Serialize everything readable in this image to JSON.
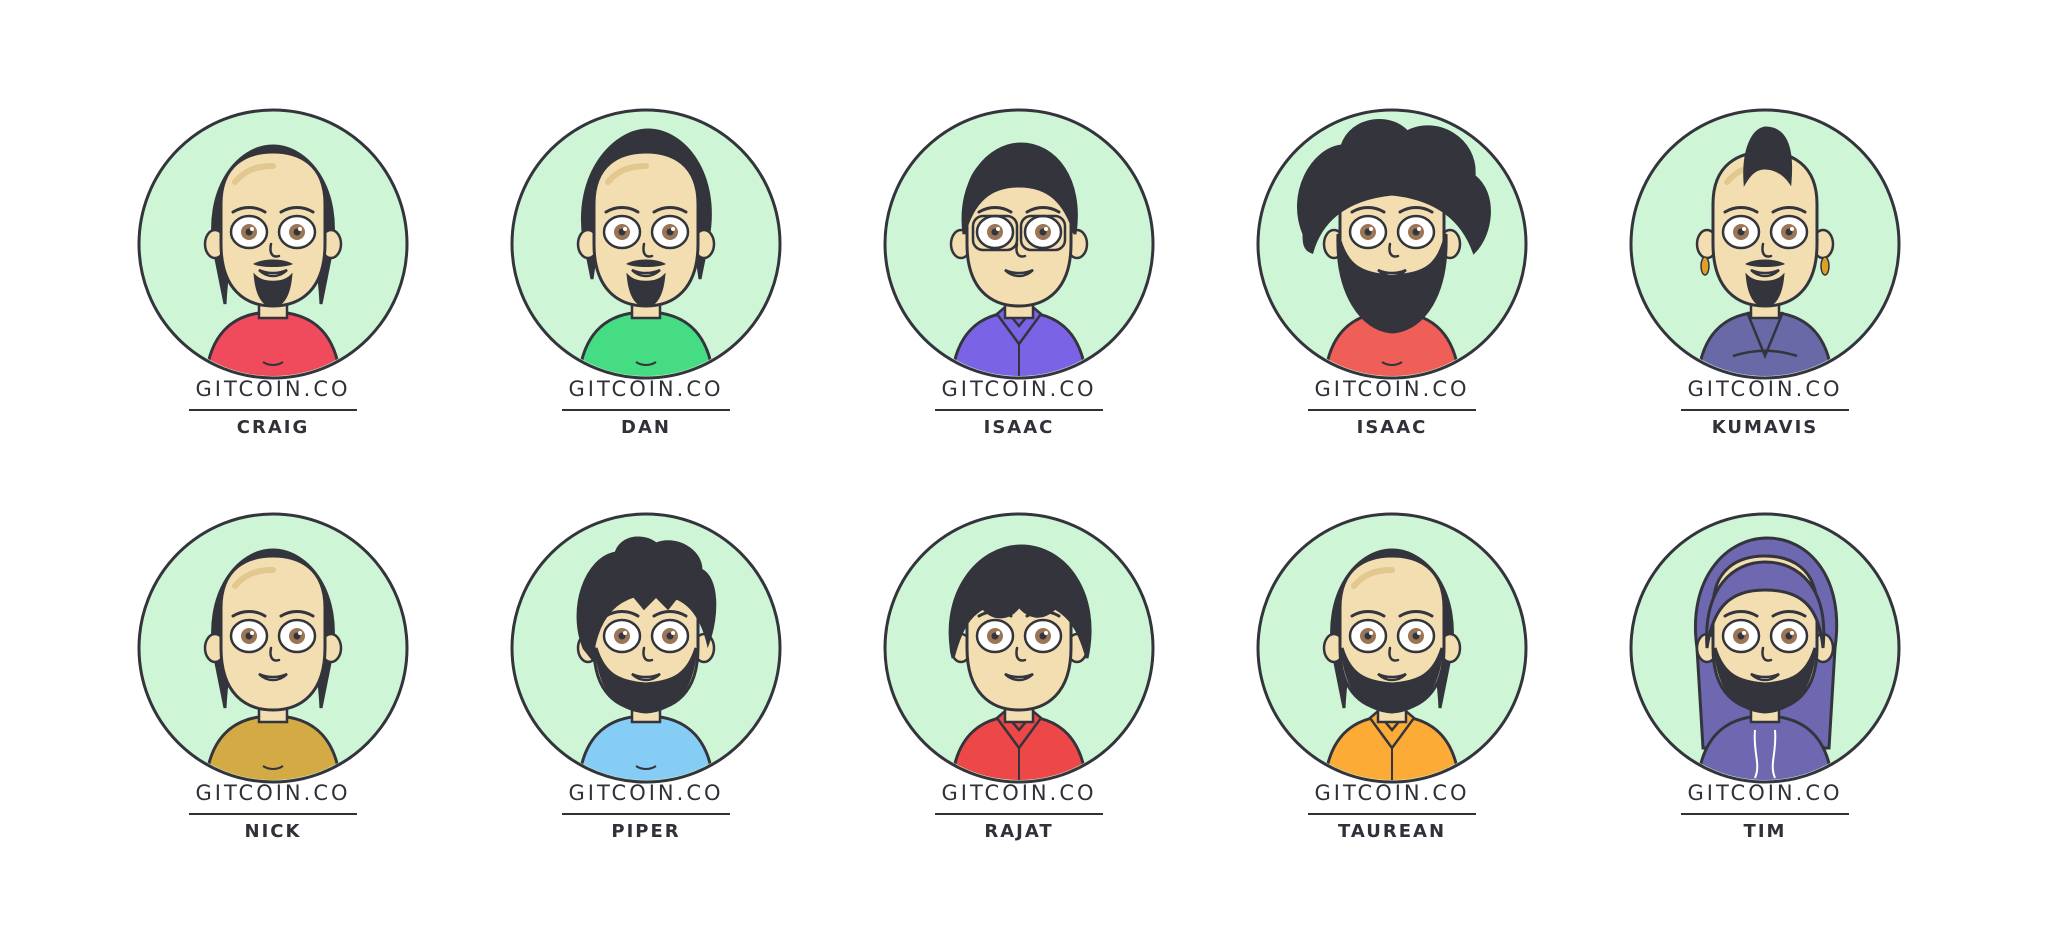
{
  "site_label": "GITCOIN.CO",
  "palette": {
    "circle_fill": "#cdf5d6",
    "outline": "#33343c",
    "skin": "#f2deb0",
    "skin_shadow": "#e2c78e",
    "hair": "#33343c",
    "eye_iris": "#9a7556"
  },
  "avatars": [
    {
      "name": "CRAIG",
      "hair": "long",
      "facial": "goatee",
      "glasses": false,
      "earrings": false,
      "hood": false,
      "shirt_color": "#f04b5c",
      "clothing_icon": "t-shirt"
    },
    {
      "name": "DAN",
      "hair": "tall",
      "facial": "goatee",
      "glasses": false,
      "earrings": false,
      "hood": false,
      "shirt_color": "#46dc84",
      "clothing_icon": "t-shirt"
    },
    {
      "name": "ISAAC",
      "hair": "short",
      "facial": "none",
      "glasses": true,
      "earrings": false,
      "hood": false,
      "shirt_color": "#7b63e6",
      "clothing_icon": "collared-shirt"
    },
    {
      "name": "ISAAC",
      "hair": "afro",
      "facial": "full-beard",
      "glasses": false,
      "earrings": false,
      "hood": false,
      "shirt_color": "#ef5f58",
      "clothing_icon": "t-shirt"
    },
    {
      "name": "KUMAVIS",
      "hair": "mohawk",
      "facial": "goatee",
      "glasses": false,
      "earrings": true,
      "hood": false,
      "shirt_color": "#6a69a8",
      "clothing_icon": "robe"
    },
    {
      "name": "NICK",
      "hair": "long",
      "facial": "none",
      "glasses": false,
      "earrings": false,
      "hood": false,
      "shirt_color": "#d4aa45",
      "clothing_icon": "t-shirt"
    },
    {
      "name": "PIPER",
      "hair": "messy",
      "facial": "beard",
      "glasses": false,
      "earrings": false,
      "hood": false,
      "shirt_color": "#86cdf6",
      "clothing_icon": "t-shirt"
    },
    {
      "name": "RAJAT",
      "hair": "bowl",
      "facial": "none",
      "glasses": false,
      "earrings": false,
      "hood": false,
      "shirt_color": "#ee4747",
      "clothing_icon": "collared-shirt"
    },
    {
      "name": "TAUREAN",
      "hair": "long",
      "facial": "beard",
      "glasses": false,
      "earrings": false,
      "hood": false,
      "shirt_color": "#fcab36",
      "clothing_icon": "collared-shirt"
    },
    {
      "name": "TIM",
      "hair": "hood",
      "facial": "beard",
      "glasses": false,
      "earrings": false,
      "hood": true,
      "shirt_color": "#6d68b0",
      "clothing_icon": "hoodie"
    }
  ]
}
